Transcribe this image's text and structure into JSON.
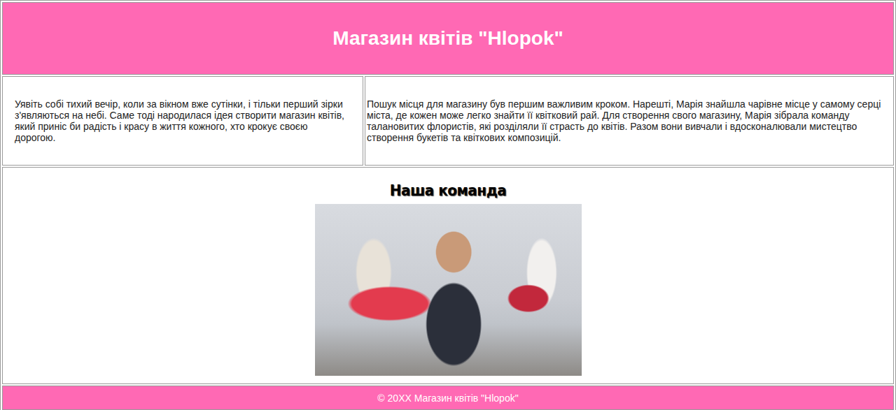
{
  "header": {
    "title": "Магазин квітів \"Hlopok\""
  },
  "intro": {
    "left": "Уявіть собі тихий вечір, коли за вікном вже сутінки, і тільки перший зірки з'являються на небі. Саме тоді народилася ідея створити магазин квітів, який приніс би радість і красу в життя кожного, хто крокує своєю дорогою.",
    "right": "Пошук місця для магазину був першим важливим кроком. Нарешті, Марія знайшла чарівне місце у самому серці міста, де кожен може легко знайти її квітковий рай. Для створення свого магазину, Марія зібрала команду талановитих флористів, які розділяли її страсть до квітів. Разом вони вивчали і вдосконалювали мистецтво створення букетів та квіткових композицій."
  },
  "team": {
    "heading": "Наша команда"
  },
  "footer": {
    "text": "© 20XX Магазин квітів \"Hlopok\""
  }
}
